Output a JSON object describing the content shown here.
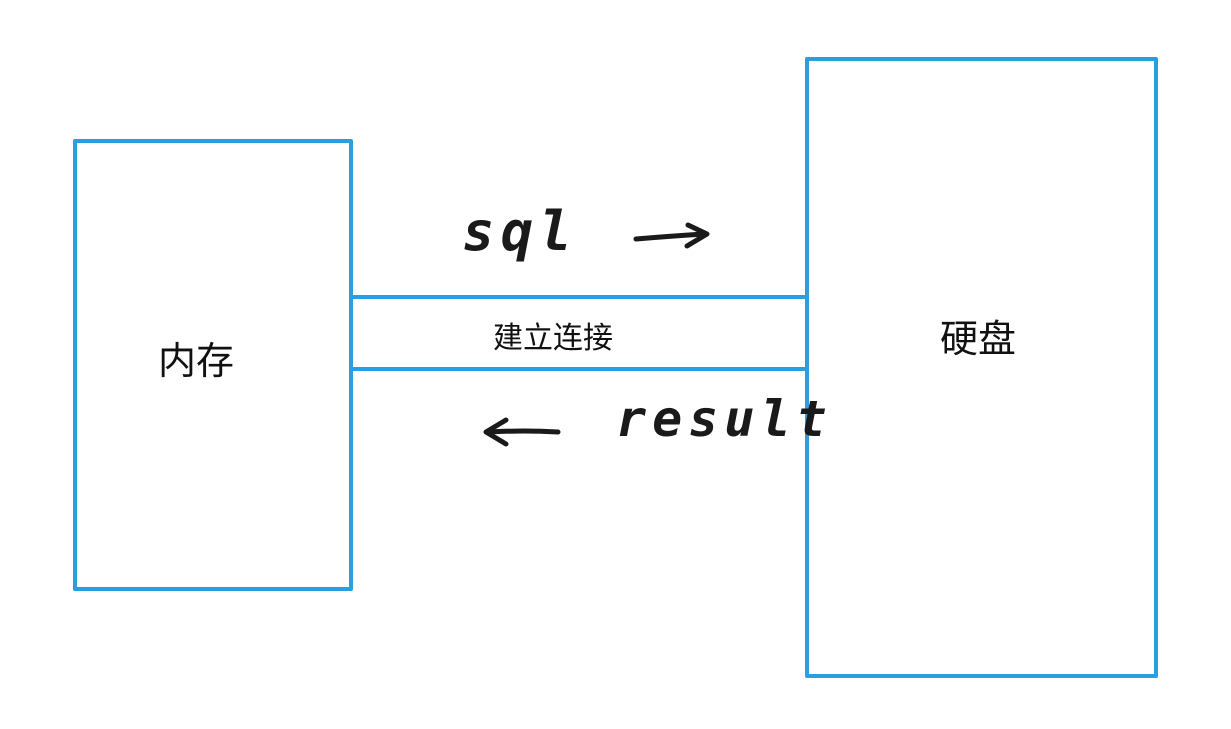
{
  "nodes": {
    "memory": "内存",
    "disk": "硬盘"
  },
  "connection": {
    "label": "建立连接",
    "request": "sql",
    "response": "result"
  },
  "colors": {
    "stroke": "#2a9fe0",
    "text": "#111111"
  },
  "icons": {
    "request_arrow": "arrow-right-icon",
    "response_arrow": "arrow-left-icon"
  }
}
